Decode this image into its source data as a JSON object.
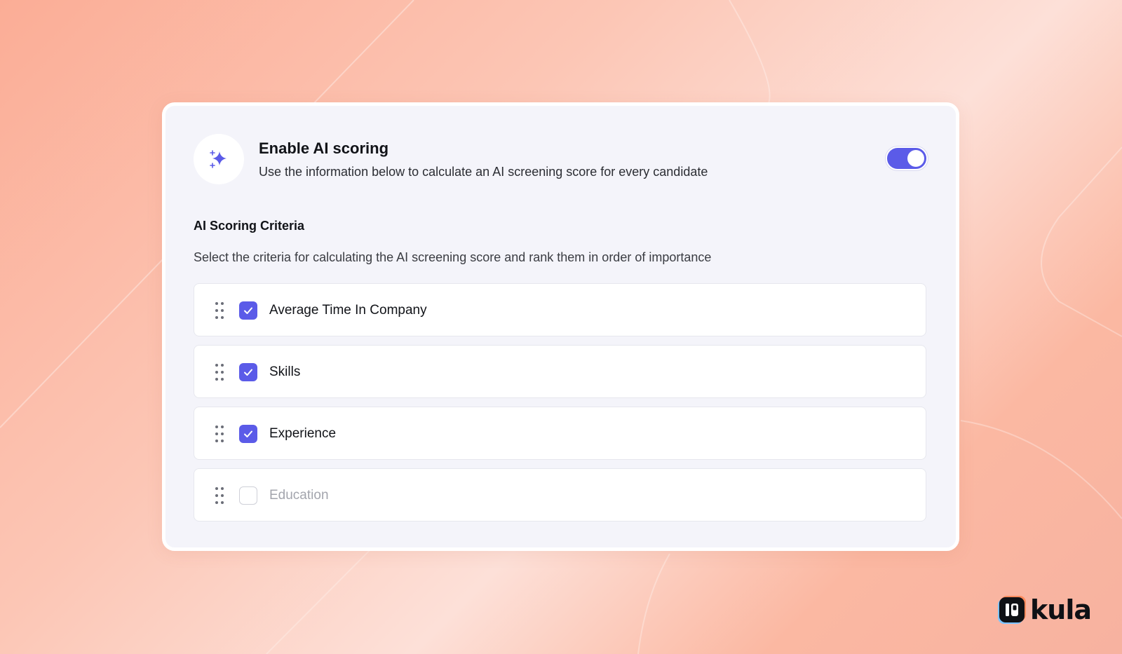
{
  "header": {
    "icon": "sparkles-icon",
    "title": "Enable AI scoring",
    "subtitle": "Use the information below to calculate an AI screening score for every candidate",
    "toggle_on": true
  },
  "section": {
    "title": "AI Scoring Criteria",
    "subtitle": "Select the criteria for calculating the AI screening score and rank them in order of importance"
  },
  "criteria": [
    {
      "label": "Average Time In Company",
      "checked": true
    },
    {
      "label": "Skills",
      "checked": true
    },
    {
      "label": "Experience",
      "checked": true
    },
    {
      "label": "Education",
      "checked": false
    }
  ],
  "brand": {
    "name": "kula",
    "accent": "#5b5be8"
  }
}
